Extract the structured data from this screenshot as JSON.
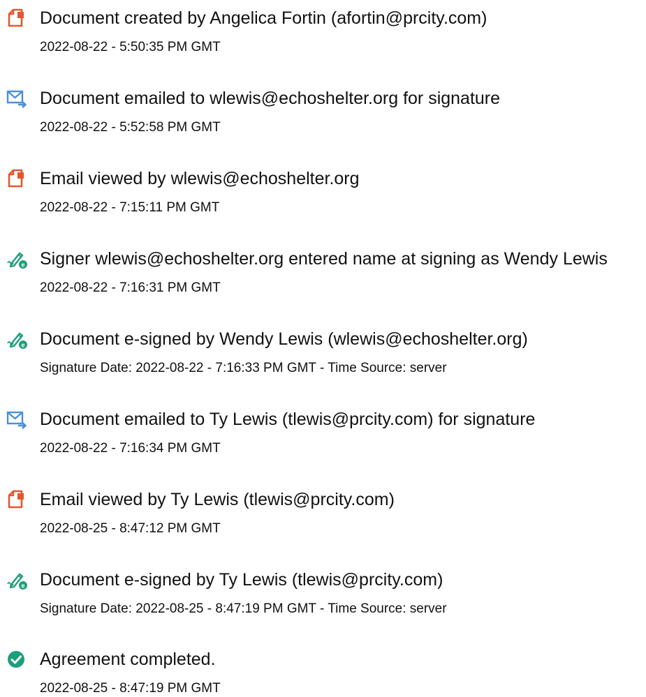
{
  "events": [
    {
      "icon": "document-created-icon",
      "title": "Document created by Angelica Fortin (afortin@prcity.com)",
      "detail": "2022-08-22 - 5:50:35 PM GMT"
    },
    {
      "icon": "email-sent-icon",
      "title": "Document emailed to wlewis@echoshelter.org for signature",
      "detail": "2022-08-22 - 5:52:58 PM GMT"
    },
    {
      "icon": "document-viewed-icon",
      "title": "Email viewed by wlewis@echoshelter.org",
      "detail": "2022-08-22 - 7:15:11 PM GMT"
    },
    {
      "icon": "esign-pen-icon",
      "title": "Signer wlewis@echoshelter.org entered name at signing as Wendy Lewis",
      "detail": "2022-08-22 - 7:16:31 PM GMT"
    },
    {
      "icon": "esign-pen-icon",
      "title": "Document e-signed by Wendy Lewis (wlewis@echoshelter.org)",
      "detail": "Signature Date: 2022-08-22 - 7:16:33 PM GMT - Time Source: server"
    },
    {
      "icon": "email-sent-icon",
      "title": "Document emailed to Ty Lewis (tlewis@prcity.com) for signature",
      "detail": "2022-08-22 - 7:16:34 PM GMT"
    },
    {
      "icon": "document-viewed-icon",
      "title": "Email viewed by Ty Lewis (tlewis@prcity.com)",
      "detail": "2022-08-25 - 8:47:12 PM GMT"
    },
    {
      "icon": "esign-pen-icon",
      "title": "Document e-signed by Ty Lewis (tlewis@prcity.com)",
      "detail": "Signature Date: 2022-08-25 - 8:47:19 PM GMT - Time Source: server"
    },
    {
      "icon": "check-circle-icon",
      "title": "Agreement completed.",
      "detail": "2022-08-25 - 8:47:19 PM GMT"
    }
  ],
  "colors": {
    "document_icon": "#E4572E",
    "email_icon": "#4A90D9",
    "esign_icon": "#1E9E7A",
    "check_icon": "#1E9E7A",
    "text": "#111111"
  }
}
